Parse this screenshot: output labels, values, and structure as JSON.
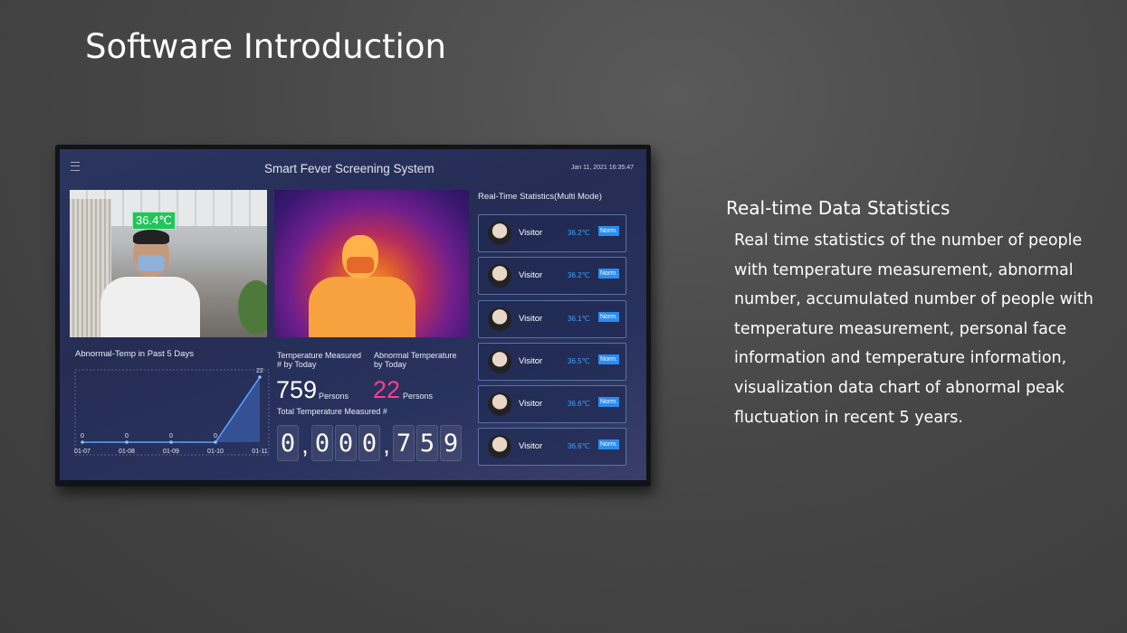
{
  "slide": {
    "title": "Software Introduction",
    "section_heading": "Real-time Data Statistics",
    "section_body": "Real time statistics of the number of people with temperature measurement, abnormal number, accumulated number of people with temperature measurement, personal face information and temperature information, visualization data chart of abnormal peak fluctuation in recent 5 years."
  },
  "screen": {
    "app_title": "Smart Fever Screening System",
    "datetime": "Jan 11, 2021 16:35:47",
    "camera_temp_badge": "36.4℃",
    "chart": {
      "title": "Abnormal-Temp in Past 5 Days",
      "categories": [
        "01-07",
        "01-08",
        "01-09",
        "01-10",
        "01-11"
      ],
      "values": [
        0,
        0,
        0,
        0,
        22
      ],
      "value_labels": [
        "0",
        "0",
        "0",
        "0",
        "22"
      ]
    },
    "stats": {
      "measured_label_1": "Temperature Measured",
      "measured_label_2": "# by Today",
      "measured_value": "759",
      "measured_unit": "Persons",
      "abnormal_label_1": "Abnormal Temperature",
      "abnormal_label_2": "by Today",
      "abnormal_value": "22",
      "abnormal_unit": "Persons",
      "total_label": "Total Temperature Measured #",
      "total_digits": [
        "0",
        ",",
        "0",
        "0",
        "0",
        ",",
        "7",
        "5",
        "9"
      ]
    },
    "realtime": {
      "title": "Real-Time Statistics(Multi Mode)",
      "items": [
        {
          "name": "Visitor",
          "temp": "36.2℃",
          "status": "Norm."
        },
        {
          "name": "Visitor",
          "temp": "36.2℃",
          "status": "Norm."
        },
        {
          "name": "Visitor",
          "temp": "36.1℃",
          "status": "Norm."
        },
        {
          "name": "Visitor",
          "temp": "36.5℃",
          "status": "Norm."
        },
        {
          "name": "Visitor",
          "temp": "36.6℃",
          "status": "Norm."
        },
        {
          "name": "Visitor",
          "temp": "36.6℃",
          "status": "Norm."
        }
      ]
    }
  },
  "colors": {
    "abnormal_accent": "#ff3d8b",
    "temp_blue": "#3ea8ff",
    "badge_green": "#23c45a"
  }
}
